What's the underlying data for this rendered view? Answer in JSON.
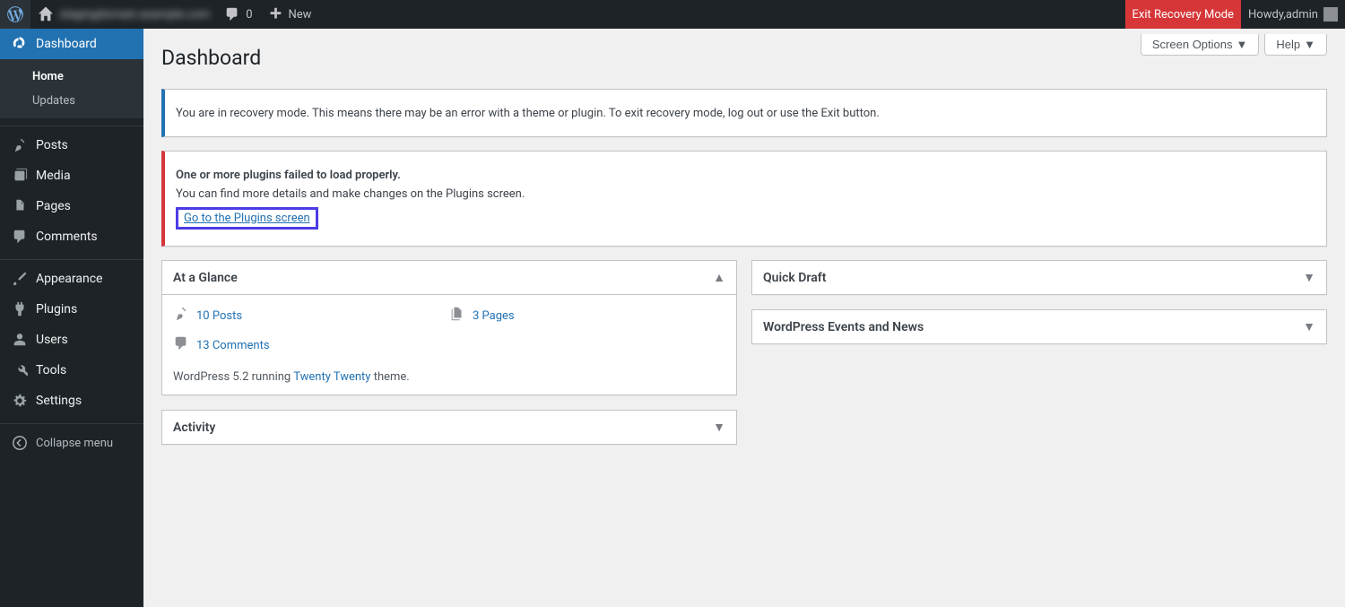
{
  "adminbar": {
    "site_name": "stagingdomain.example.com",
    "comments_count": "0",
    "new_label": "New",
    "exit_recovery": "Exit Recovery Mode",
    "howdy_prefix": "Howdy, ",
    "user_name": "admin"
  },
  "sidebar": {
    "items": [
      {
        "label": "Dashboard"
      },
      {
        "label": "Posts"
      },
      {
        "label": "Media"
      },
      {
        "label": "Pages"
      },
      {
        "label": "Comments"
      },
      {
        "label": "Appearance"
      },
      {
        "label": "Plugins"
      },
      {
        "label": "Users"
      },
      {
        "label": "Tools"
      },
      {
        "label": "Settings"
      }
    ],
    "submenu_dashboard": [
      {
        "label": "Home"
      },
      {
        "label": "Updates"
      }
    ],
    "collapse_label": "Collapse menu"
  },
  "topbuttons": {
    "screen_options": "Screen Options",
    "help": "Help"
  },
  "page_title": "Dashboard",
  "notice_info": {
    "text": "You are in recovery mode. This means there may be an error with a theme or plugin. To exit recovery mode, log out or use the Exit button."
  },
  "notice_error": {
    "title": "One or more plugins failed to load properly.",
    "body": "You can find more details and make changes on the Plugins screen.",
    "link": "Go to the Plugins screen"
  },
  "glance": {
    "title": "At a Glance",
    "posts": "10 Posts",
    "pages": "3 Pages",
    "comments": "13 Comments",
    "version_prefix": "WordPress 5.2 running ",
    "theme": "Twenty Twenty",
    "version_suffix": " theme."
  },
  "activity": {
    "title": "Activity"
  },
  "quickdraft": {
    "title": "Quick Draft"
  },
  "news": {
    "title": "WordPress Events and News"
  }
}
